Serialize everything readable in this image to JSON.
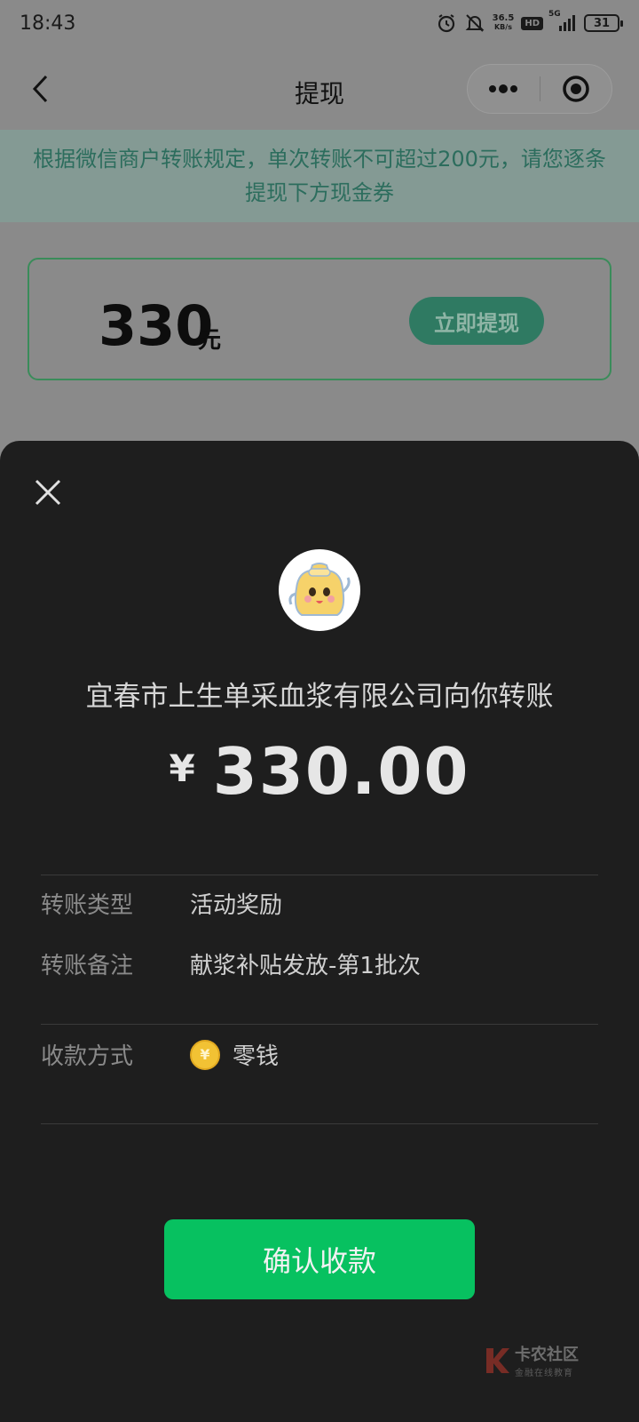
{
  "status_bar": {
    "time": "18:43",
    "net_speed": "36.5",
    "net_unit": "KB/s",
    "hd": "HD",
    "network": "5G",
    "battery": "31"
  },
  "nav": {
    "title": "提现"
  },
  "notice": {
    "text": "根据微信商户转账规定，单次转账不可超过200元，请您逐条提现下方现金券"
  },
  "card": {
    "amount": "330",
    "unit": "元",
    "button": "立即提现"
  },
  "sheet": {
    "payer": "宜春市上生单采血浆有限公司向你转账",
    "currency": "¥",
    "amount": "330.00",
    "details": [
      {
        "key": "转账类型",
        "value": "活动奖励"
      },
      {
        "key": "转账备注",
        "value": "献浆补贴发放-第1批次"
      }
    ],
    "payment_method": {
      "key": "收款方式",
      "value": "零钱",
      "coin_symbol": "¥"
    },
    "confirm": "确认收款"
  },
  "watermark": {
    "title": "卡农社区",
    "subtitle": "金融在线教育"
  },
  "colors": {
    "brand_green": "#07c160",
    "sheet_bg": "#1e1e1e",
    "notice_text": "#2c6d5d"
  }
}
